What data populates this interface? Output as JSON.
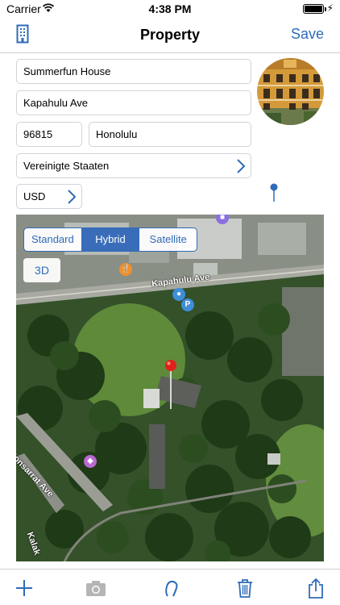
{
  "status_bar": {
    "carrier": "Carrier",
    "time": "4:38 PM",
    "battery_level": 1.0
  },
  "nav": {
    "title": "Property",
    "save_label": "Save",
    "left_icon": "building-icon"
  },
  "form": {
    "name": "Summerfun House",
    "street": "Kapahulu Ave",
    "zip": "96815",
    "city": "Honolulu",
    "country": "Vereinigte Staaten",
    "currency": "USD"
  },
  "map": {
    "map_types": [
      "Standard",
      "Hybrid",
      "Satellite"
    ],
    "selected_map_type": "Hybrid",
    "button_3d": "3D",
    "streets": [
      "Kapahulu Ave",
      "Monsarrat Ave",
      "Kalak"
    ]
  },
  "toolbar": {
    "icons": [
      "plus-icon",
      "camera-icon",
      "lasso-icon",
      "trash-icon",
      "share-icon"
    ]
  },
  "colors": {
    "accent": "#2f6bb8",
    "pin": "#e0211c"
  }
}
